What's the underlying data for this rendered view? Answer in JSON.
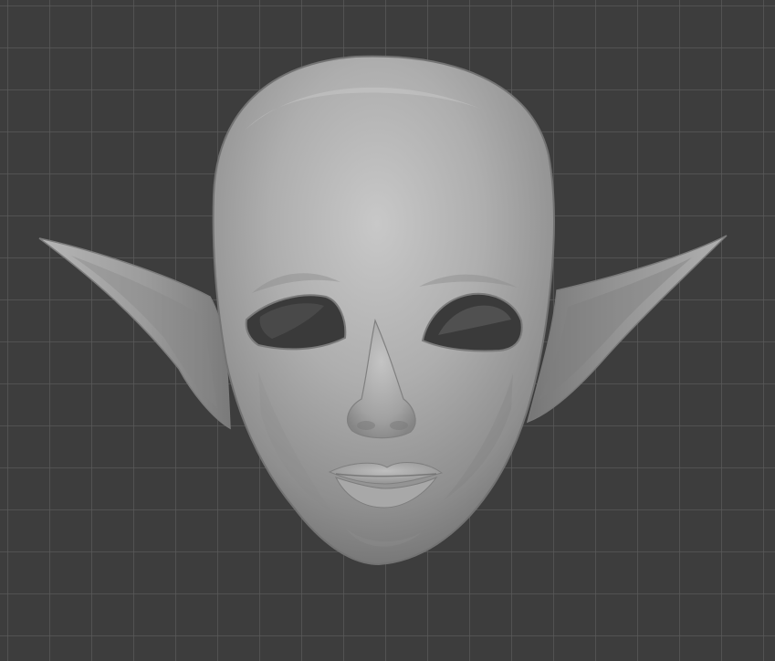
{
  "viewport": {
    "label": "",
    "background": "#3d3d3d",
    "grid_color": "#5a5a5a"
  },
  "model": {
    "description_color": "#a9a9a9",
    "shade_dark": "#6f6f6f",
    "shade_light": "#c7c7c7"
  }
}
